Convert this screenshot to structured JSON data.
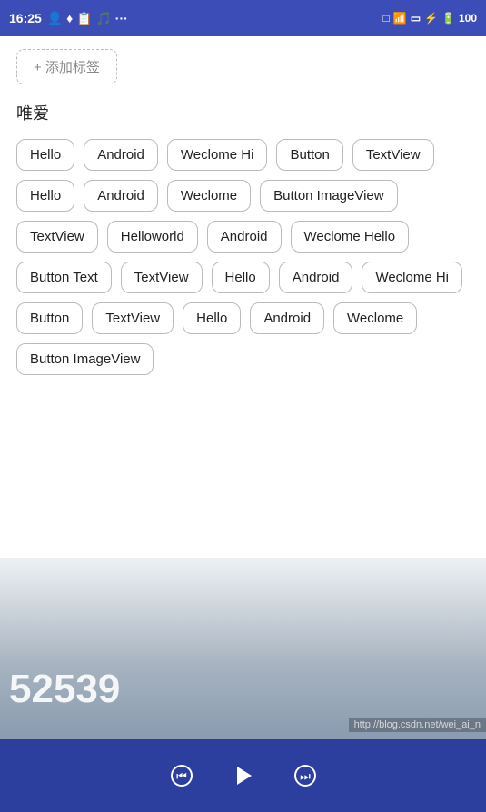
{
  "status_bar": {
    "time": "16:25",
    "battery": "100",
    "signal_icons": "📶",
    "right_icons": "▣ ⊡ ⚡ 🔋"
  },
  "add_tag_button": {
    "label": "+ 添加标签"
  },
  "section": {
    "label": "唯爱"
  },
  "tags": [
    "Hello",
    "Android",
    "Weclome Hi",
    "Button",
    "TextView",
    "Hello",
    "Android",
    "Weclome",
    "Button ImageView",
    "TextView",
    "Helloworld",
    "Android",
    "Weclome Hello",
    "Button Text",
    "TextView",
    "Hello",
    "Android",
    "Weclome Hi",
    "Button",
    "TextView",
    "Hello",
    "Android",
    "Weclome",
    "Button ImageView"
  ],
  "bottom_number": "52539",
  "watermark": "http://blog.csdn.net/wei_ai_n",
  "nav": {
    "back_label": "⏮",
    "play_label": "▶",
    "forward_label": "⏭"
  }
}
